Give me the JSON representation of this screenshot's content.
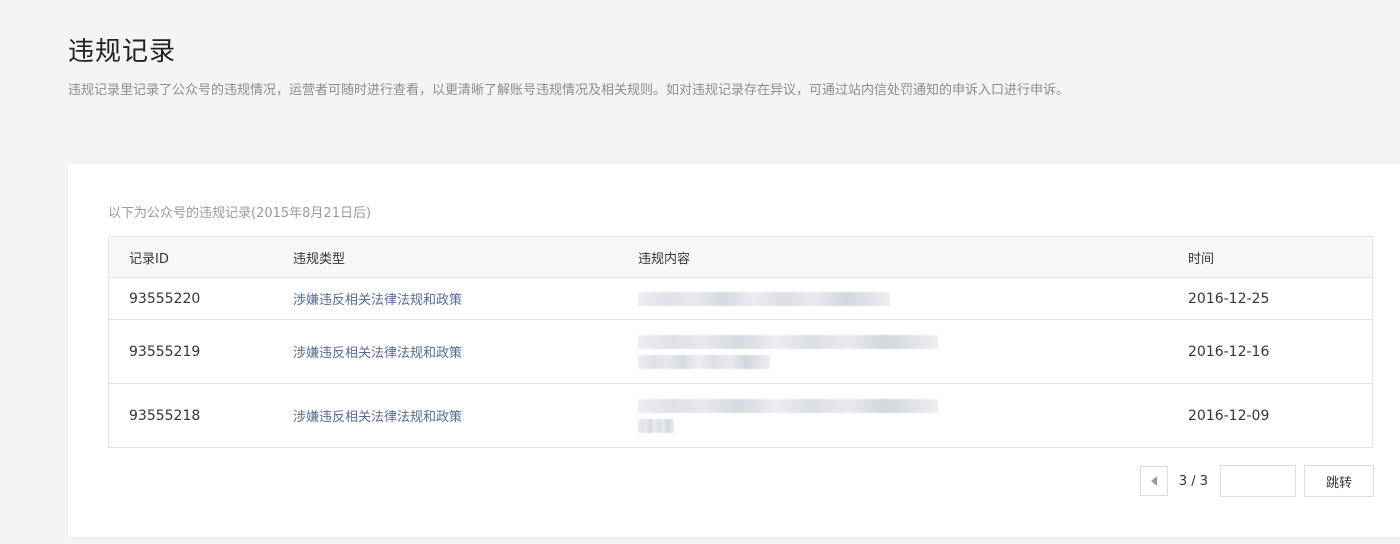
{
  "page": {
    "title": "违规记录",
    "description": "违规记录里记录了公众号的违规情况，运营者可随时进行查看，以更清晰了解账号违规情况及相关规则。如对违规记录存在异议，可通过站内信处罚通知的申诉入口进行申诉。"
  },
  "records": {
    "caption": "以下为公众号的违规记录(2015年8月21日后)",
    "columns": {
      "id": "记录ID",
      "type": "违规类型",
      "content": "违规内容",
      "time": "时间"
    },
    "rows": [
      {
        "id": "93555220",
        "type": "涉嫌违反相关法律法规和政策",
        "content": "[blurred]",
        "time": "2016-12-25"
      },
      {
        "id": "93555219",
        "type": "涉嫌违反相关法律法规和政策",
        "content": "[blurred]",
        "time": "2016-12-16"
      },
      {
        "id": "93555218",
        "type": "涉嫌违反相关法律法规和政策",
        "content": "[blurred]",
        "time": "2016-12-09"
      }
    ]
  },
  "pager": {
    "current": "3 / 3",
    "input_value": "",
    "go_label": "跳转",
    "prev_icon": "triangle-left-icon"
  },
  "colors": {
    "background": "#f3f4f6",
    "card": "#ffffff",
    "link": "#576b95",
    "header_bg": "#f6f7f9",
    "border": "#e5e5e8"
  }
}
